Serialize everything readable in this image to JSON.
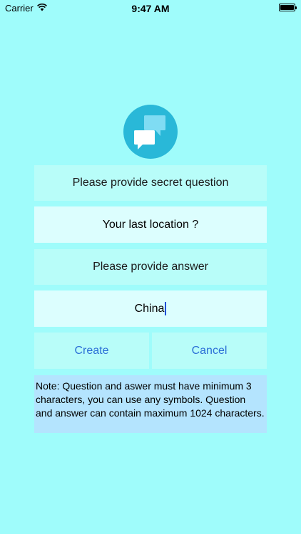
{
  "status_bar": {
    "carrier": "Carrier",
    "time": "9:47 AM"
  },
  "form": {
    "question_prompt": "Please provide secret question",
    "question_value": "Your last location ?",
    "answer_prompt": "Please provide answer",
    "answer_value": "China"
  },
  "buttons": {
    "create": "Create",
    "cancel": "Cancel"
  },
  "note": "Note: Question and aswer must have minimum 3 characters, you can use any symbols. Question and answer can contain maximum 1024 characters.",
  "icons": {
    "wifi": "wifi-icon",
    "battery": "battery-icon",
    "logo": "chat-bubbles-icon"
  },
  "colors": {
    "background": "#9ffcfb",
    "panel": "#b8fdf9",
    "input": "#dcfefe",
    "note": "#b4e4fe",
    "accent": "#2b6fd6",
    "logo": "#29b8d8"
  }
}
